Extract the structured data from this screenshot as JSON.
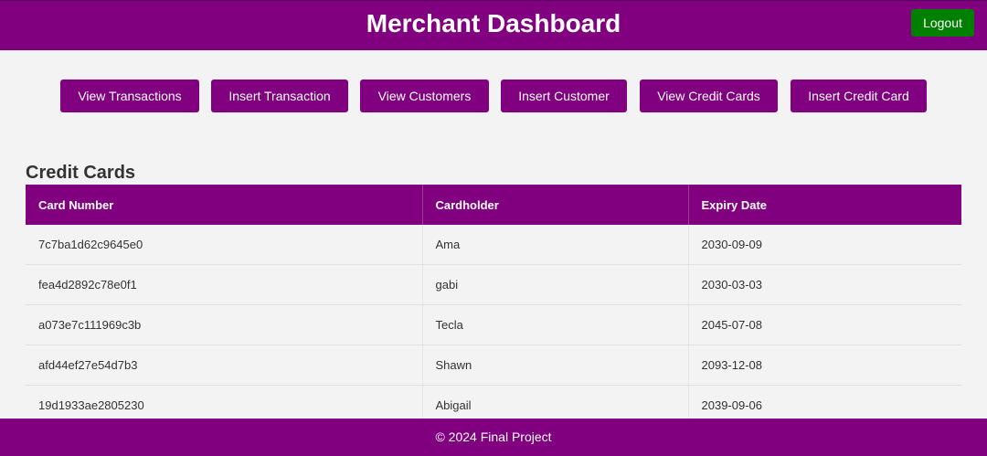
{
  "header": {
    "title": "Merchant Dashboard",
    "logout_label": "Logout"
  },
  "nav": {
    "buttons": [
      {
        "label": "View Transactions"
      },
      {
        "label": "Insert Transaction"
      },
      {
        "label": "View Customers"
      },
      {
        "label": "Insert Customer"
      },
      {
        "label": "View Credit Cards"
      },
      {
        "label": "Insert Credit Card"
      }
    ]
  },
  "main": {
    "section_title": "Credit Cards",
    "table": {
      "columns": [
        "Card Number",
        "Cardholder",
        "Expiry Date"
      ],
      "rows": [
        [
          "7c7ba1d62c9645e0",
          "Ama",
          "2030-09-09"
        ],
        [
          "fea4d2892c78e0f1",
          "gabi",
          "2030-03-03"
        ],
        [
          "a073e7c111969c3b",
          "Tecla",
          "2045-07-08"
        ],
        [
          "afd44ef27e54d7b3",
          "Shawn",
          "2093-12-08"
        ],
        [
          "19d1933ae2805230",
          "Abigail",
          "2039-09-06"
        ]
      ]
    }
  },
  "footer": {
    "text": "© 2024 Final Project"
  },
  "colors": {
    "brand": "#800080",
    "logout": "#008000",
    "background": "#f3f3f3"
  }
}
